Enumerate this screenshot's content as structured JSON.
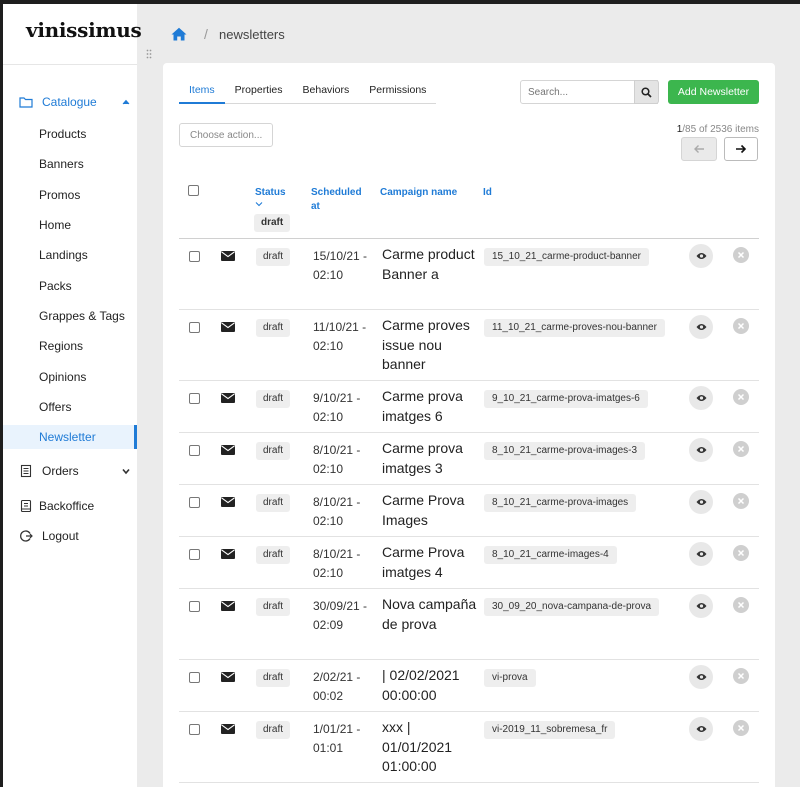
{
  "app": {
    "logo": "vinissimus"
  },
  "sidebar": {
    "catalogue_label": "Catalogue",
    "items": [
      {
        "label": "Products"
      },
      {
        "label": "Banners"
      },
      {
        "label": "Promos"
      },
      {
        "label": "Home"
      },
      {
        "label": "Landings"
      },
      {
        "label": "Packs"
      },
      {
        "label": "Grappes & Tags"
      },
      {
        "label": "Regions"
      },
      {
        "label": "Opinions"
      },
      {
        "label": "Offers"
      },
      {
        "label": "Newsletter",
        "active": true
      }
    ],
    "orders_label": "Orders",
    "backoffice_label": "Backoffice",
    "logout_label": "Logout"
  },
  "breadcrumb": {
    "separator": "/",
    "current": "newsletters"
  },
  "tabs": [
    {
      "label": "Items",
      "active": true
    },
    {
      "label": "Properties"
    },
    {
      "label": "Behaviors"
    },
    {
      "label": "Permissions"
    }
  ],
  "search": {
    "placeholder": "Search..."
  },
  "toolbar": {
    "add_label": "Add Newsletter",
    "choose_action": "Choose action..."
  },
  "pagination": {
    "current": "1",
    "total_pages": "/85",
    "items_text": "of 2536 items"
  },
  "table": {
    "headers": {
      "status": "Status",
      "scheduled": "Scheduled at",
      "campaign": "Campaign name",
      "id": "Id"
    },
    "status_filter": "draft",
    "rows": [
      {
        "status": "draft",
        "scheduled": "15/10/21 - 02:10",
        "campaign": "Carme product Banner a",
        "id": "15_10_21_carme-product-banner"
      },
      {
        "status": "draft",
        "scheduled": "11/10/21 - 02:10",
        "campaign": "Carme proves issue nou banner",
        "id": "11_10_21_carme-proves-nou-banner"
      },
      {
        "status": "draft",
        "scheduled": "9/10/21 - 02:10",
        "campaign": "Carme prova imatges 6",
        "id": "9_10_21_carme-prova-imatges-6"
      },
      {
        "status": "draft",
        "scheduled": "8/10/21 - 02:10",
        "campaign": "Carme prova imatges 3",
        "id": "8_10_21_carme-prova-images-3"
      },
      {
        "status": "draft",
        "scheduled": "8/10/21 - 02:10",
        "campaign": "Carme Prova Images",
        "id": "8_10_21_carme-prova-images"
      },
      {
        "status": "draft",
        "scheduled": "8/10/21 - 02:10",
        "campaign": "Carme Prova imatges 4",
        "id": "8_10_21_carme-images-4"
      },
      {
        "status": "draft",
        "scheduled": "30/09/21 - 02:09",
        "campaign": "Nova campaña de prova",
        "id": "30_09_20_nova-campana-de-prova"
      },
      {
        "status": "draft",
        "scheduled": "2/02/21 - 00:02",
        "campaign": "| 02/02/2021 00:00:00",
        "id": "vi-prova"
      },
      {
        "status": "draft",
        "scheduled": "1/01/21 - 01:01",
        "campaign": "xxx | 01/01/2021 01:00:00",
        "id": "vi-2019_11_sobremesa_fr"
      }
    ]
  },
  "colors": {
    "accent": "#1f7bd6",
    "add_button": "#3cb64e"
  }
}
